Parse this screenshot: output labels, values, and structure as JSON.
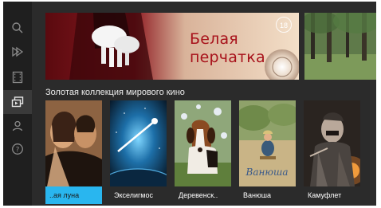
{
  "sidebar": {
    "items": [
      {
        "id": "search",
        "icon": "search-icon"
      },
      {
        "id": "play",
        "icon": "play-icon"
      },
      {
        "id": "film",
        "icon": "film-icon"
      },
      {
        "id": "library",
        "icon": "library-icon",
        "active": true
      },
      {
        "id": "profile",
        "icon": "user-icon"
      },
      {
        "id": "help",
        "icon": "help-icon"
      }
    ]
  },
  "banner": {
    "title": "Белая перчатка",
    "age_rating": "18"
  },
  "collection": {
    "title": "Золотая коллекция мирового кино",
    "items": [
      {
        "label": "..ая луна",
        "selected": true
      },
      {
        "label": "Экселигмос"
      },
      {
        "label": "Деревенск.."
      },
      {
        "label": "Ванюша"
      },
      {
        "label": "Камуфлет"
      }
    ]
  },
  "colors": {
    "accent": "#29b6ef",
    "banner_title": "#a8121b",
    "background": "#2b2b2b",
    "sidebar": "#1f1f1f"
  }
}
